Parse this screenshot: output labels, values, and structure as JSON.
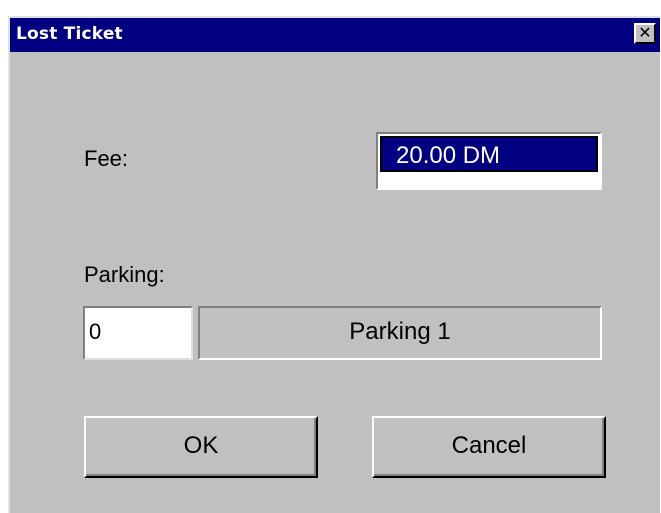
{
  "window": {
    "title": "Lost Ticket",
    "close_glyph": "✕",
    "close_icon": "close-icon"
  },
  "fee": {
    "label": "Fee:",
    "value": "20.00 DM"
  },
  "parking": {
    "label": "Parking:",
    "number": "0",
    "name": "Parking 1"
  },
  "buttons": {
    "ok_label": "OK",
    "cancel_label": "Cancel"
  },
  "colors": {
    "titlebar": "#000080",
    "dialog_bg": "#c0c0c0",
    "selection": "#000080"
  }
}
